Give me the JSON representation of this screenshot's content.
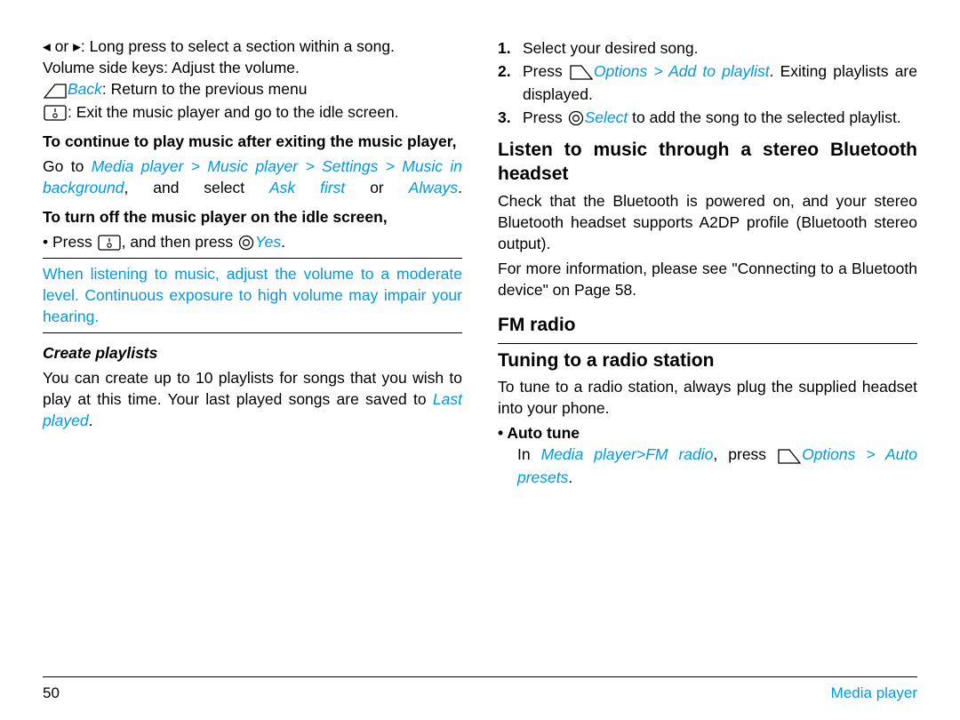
{
  "left": {
    "l1a": "◂ or ▸: Long press to select a section within a song.",
    "l2": "Volume side keys: Adjust the volume.",
    "l3_back": "Back",
    "l3_rest": ": Return to the previous menu",
    "l4": ": Exit the music player and go to the idle screen.",
    "h1": "To continue to play music after exiting the music player,",
    "p1a": "Go to ",
    "p1b": "Media player > Music player > Settings > Music in background",
    "p1c": ", and select ",
    "p1d": "Ask first",
    "p1e": " or ",
    "p1f": "Always",
    "p1g": ".",
    "h2": "To turn off the music player on the idle screen,",
    "p2a": "• Press ",
    "p2b": ", and then press ",
    "p2c": "Yes",
    "p2d": ".",
    "warn": "When listening to music, adjust the volume to a moderate level. Continuous exposure to high volume may impair your hearing.",
    "h3": "Create playlists",
    "p3a": "You can create up to 10 playlists for songs that you wish to play at this time. Your last played songs are saved to ",
    "p3b": "Last played",
    "p3c": "."
  },
  "right": {
    "o1": "Select your desired song.",
    "o2a": "Press ",
    "o2b": "Options > Add to playlist",
    "o2c": ". Exiting playlists are displayed.",
    "o3a": "Press ",
    "o3b": "Select",
    "o3c": " to add the song to the selected playlist.",
    "h1": "Listen to music through a stereo Bluetooth headset",
    "p1": "Check that the Bluetooth is powered on, and your stereo Bluetooth headset supports A2DP profile (Bluetooth stereo output).",
    "p2": "For more information, please see \"Connecting to a Bluetooth device\" on Page 58.",
    "h2": "FM radio",
    "h3": "Tuning to a radio station",
    "p3": "To tune to a radio station, always plug the supplied headset into your phone.",
    "sub": "• Auto tune",
    "p4a": "In ",
    "p4b": "Media player>FM radio",
    "p4c": ", press ",
    "p4d": "Options > Auto presets",
    "p4e": "."
  },
  "footer": {
    "page": "50",
    "section": "Media player"
  },
  "ol": {
    "n1": "1.",
    "n2": "2.",
    "n3": "3."
  }
}
